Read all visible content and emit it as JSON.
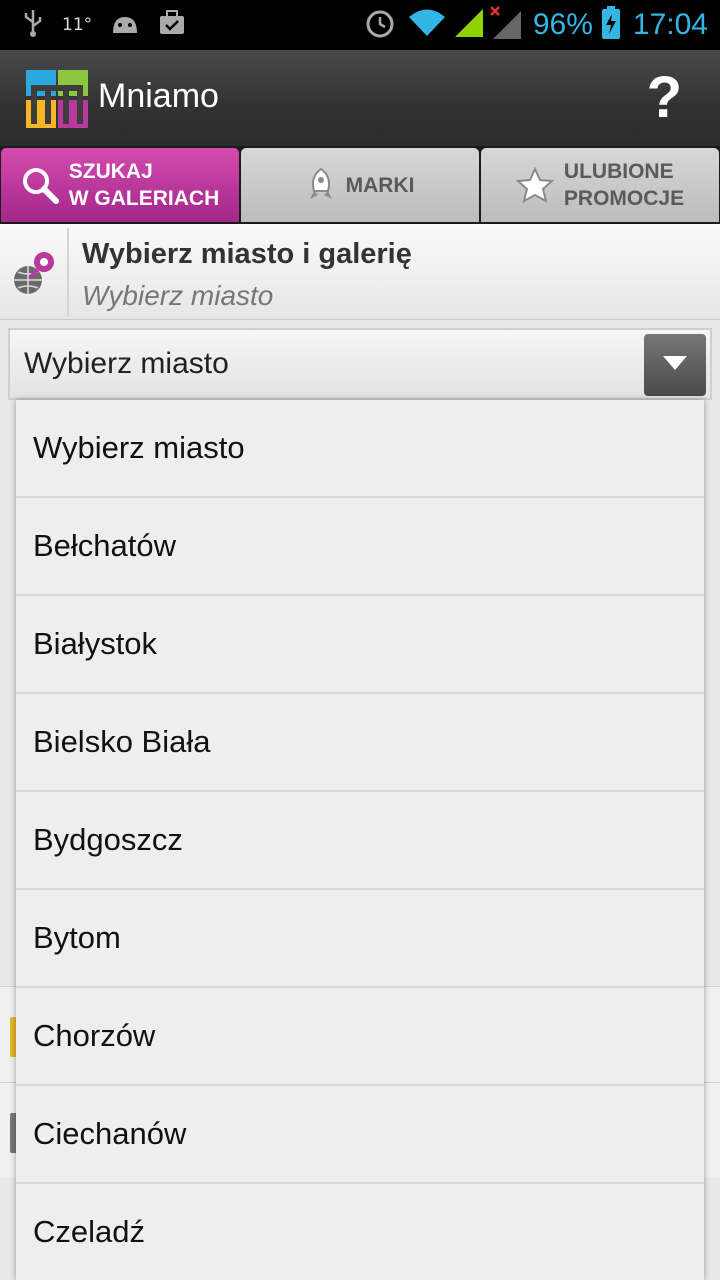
{
  "status_bar": {
    "temperature": "11°",
    "battery_percent": "96%",
    "time": "17:04",
    "icons": [
      "usb-icon",
      "android-icon",
      "briefcase-icon",
      "alarm-icon",
      "wifi-icon",
      "signal-icon",
      "signal-no-service-icon",
      "battery-charging-icon"
    ]
  },
  "action_bar": {
    "app_title": "Mniamo",
    "help_label": "?"
  },
  "tabs": [
    {
      "line1": "SZUKAJ",
      "line2": "W GALERIACH",
      "icon": "search-icon",
      "active": true
    },
    {
      "line1": "MARKI",
      "line2": "",
      "icon": "rocket-tag-icon",
      "active": false
    },
    {
      "line1": "ULUBIONE",
      "line2": "PROMOCJE",
      "icon": "star-icon",
      "active": false
    }
  ],
  "header": {
    "title": "Wybierz miasto i galerię",
    "subtitle": "Wybierz miasto"
  },
  "spinner": {
    "selected": "Wybierz miasto"
  },
  "dropdown": {
    "items": [
      "Wybierz miasto",
      "Bełchatów",
      "Białystok",
      "Bielsko Biała",
      "Bydgoszcz",
      "Bytom",
      "Chorzów",
      "Ciechanów",
      "Czeladź"
    ]
  },
  "colors": {
    "accent_magenta": "#b8389c",
    "status_blue": "#33b5e5"
  }
}
